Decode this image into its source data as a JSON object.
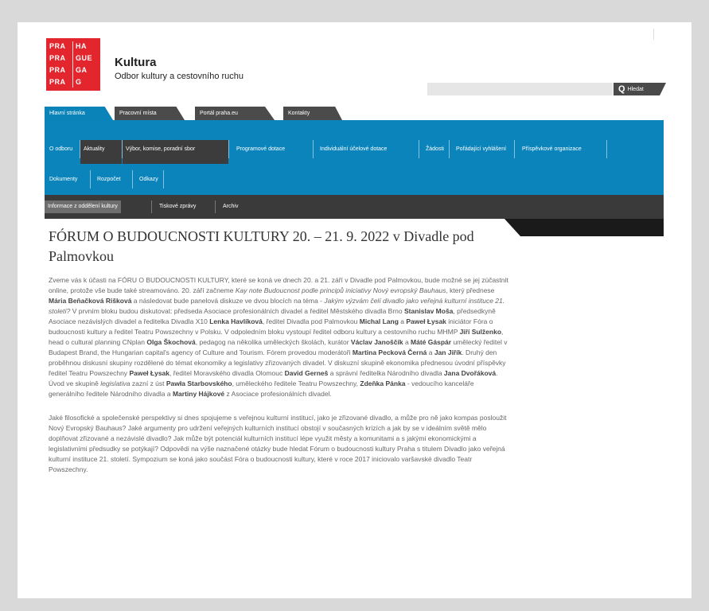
{
  "logo": {
    "words": [
      "PRA",
      "HA",
      "PRA",
      "GUE",
      "PRA",
      "GA",
      "PRA",
      "G"
    ],
    "color": "#e3262e"
  },
  "header": {
    "title": "Kultura",
    "subtitle": "Odbor kultury a cestovního ruchu"
  },
  "search": {
    "placeholder": "",
    "button_label": "Hledat",
    "icon": "search-icon"
  },
  "tabs": [
    {
      "label": "Hlavní stránka",
      "active": true
    },
    {
      "label": "Pracovní místa",
      "active": false
    },
    {
      "label": "Portál praha.eu",
      "active": false
    },
    {
      "label": "Kontakty",
      "active": false
    }
  ],
  "main_nav": {
    "row1": [
      "O odboru",
      "Aktuality",
      "Výbor, komise, poradní sbor",
      "Programové dotace",
      "Individuální účelové dotace",
      "Žádosti",
      "Pořádající vyhlášení",
      "Příspěvkové organizace"
    ],
    "row2": [
      "Dokumenty",
      "Rozpočet",
      "Odkazy"
    ]
  },
  "sub_nav": [
    "Informace z oddělení kultury",
    "Tiskové zprávy",
    "Archiv"
  ],
  "colors": {
    "accent_blue": "#0a84ba",
    "dark": "#3a3a3a",
    "brand_red": "#e3262e"
  },
  "article": {
    "title": "FÓRUM O BUDOUCNOSTI KULTURY 20. – 21. 9. 2022 v Divadle pod Palmovkou",
    "p1": {
      "s1": "Zveme vás k účasti na FÓRU O BUDOUCNOSTI KULTURY, které se koná ve dnech 20. a 21. září v Divadle pod Palmovkou, bude možné se jej zúčastnit online, protože vše bude také streamováno. 20. září začneme ",
      "s2": "Kay note Budoucnost podle principů iniciativy Nový evropský Bauhaus",
      "s3": ", který přednese ",
      "n1": "Mária Beňačková Rišková",
      "s4": " a následovat bude panelová diskuze ve dvou blocích na téma - ",
      "s5": "Jakým výzvám čelí divadlo jako veřejná kulturní instituce 21. století?",
      "s6": " V prvním bloku budou diskutovat: předseda Asociace profesionálních divadel a ředitel Městského divadla Brno ",
      "n2": "Stanislav Moša",
      "s7": ", předsedkyně Asociace nezávislých divadel a ředitelka Divadla X10 ",
      "n3": "Lenka Havlíková",
      "s8": ", ředitel Divadla pod Palmovkou ",
      "n4": "Michal Lang",
      "s9": " a ",
      "n5": "Paweł Łysak",
      "s10": " iniciátor Fóra o budoucnosti kultury a ředitel Teatru Powszechny v Polsku. V odpoledním bloku vystoupí ředitel odboru kultury a cestovního ruchu MHMP ",
      "n6": "Jiří Sulženko",
      "s11": ", head o cultural planning CNplan ",
      "n7": "Olga Škochová",
      "s12": ", pedagog na několika uměleckých školách, kurátor ",
      "n8": "Václav Janoščík",
      "s13": " a ",
      "n9": "Máté Gáspár",
      "s14": " umělecký ředitel v Budapest Brand, the Hungarian capital's agency of Culture and Tourism. Fórem provedou moderátoři ",
      "n10": "Martina Pecková Černá",
      "s15": " a ",
      "n11": "Jan Jiřík",
      "s16": ". Druhý den proběhnou diskusní skupiny rozdělené do témat ekonomiky a legislativy zřizovaných divadel. V diskuzní skupině ekonomika přednesou úvodní příspěvky ředitel Teatru Powszechny ",
      "n12": "Paweł Łysak",
      "s17": ", ředitel Moravského divadla Olomouc ",
      "n13": "David Gerneš",
      "s18": " a správní ředitelka Národního divadla ",
      "n14": "Jana Dvořáková",
      "s19": ". Úvod ve skupině ",
      "s20": "legislativa",
      "s21": " zazní z úst ",
      "n15": "Pawła Starbovského",
      "s22": ", uměleckého ředitele Teatru Powszechny, ",
      "n16": "Zdeňka Pánka",
      "s23": " - vedoucího kanceláře generálního ředitele Národního divadla a ",
      "n17": "Martiny Hájkové",
      "s24": " z Asociace profesionálních divadel."
    },
    "p2": "Jaké filosofické a společenské perspektivy si dnes spojujeme s veřejnou kulturní institucí, jako je zřizované divadlo, a může pro ně jako kompas posloužit Nový Evropský Bauhaus? Jaké argumenty pro udržení veřejných kulturních institucí obstojí v současných krizích a jak by se v ideálním světě mělo doplňovat zřizované a nezávislé divadlo? Jak může být potenciál kulturních institucí lépe využit městy a komunitami a s jakými ekonomickými a legislativními předsudky se potýkají? Odpovědi na výše naznačené otázky bude hledat Fórum o budoucnosti kultury Praha s titulem Divadlo jako veřejná kulturní instituce 21. století. Sympozium se koná jako součást Fóra o budoucnosti kultury, které v roce 2017 iniciovalo varšavské divadlo Teatr Powszechny."
  }
}
